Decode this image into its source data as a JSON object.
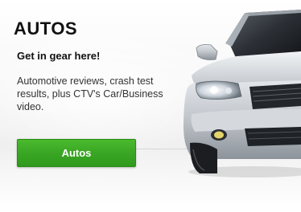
{
  "ad": {
    "title": "AUTOS",
    "tagline": "Get in gear here!",
    "description": "Automotive reviews, crash test results, plus CTV's Car/Business video.",
    "button_label": "Autos"
  },
  "colors": {
    "button_green": "#3aa624",
    "text_dark": "#111111",
    "car_silver": "#c9cdd2"
  },
  "icons": {
    "car_image": "car-photo"
  }
}
